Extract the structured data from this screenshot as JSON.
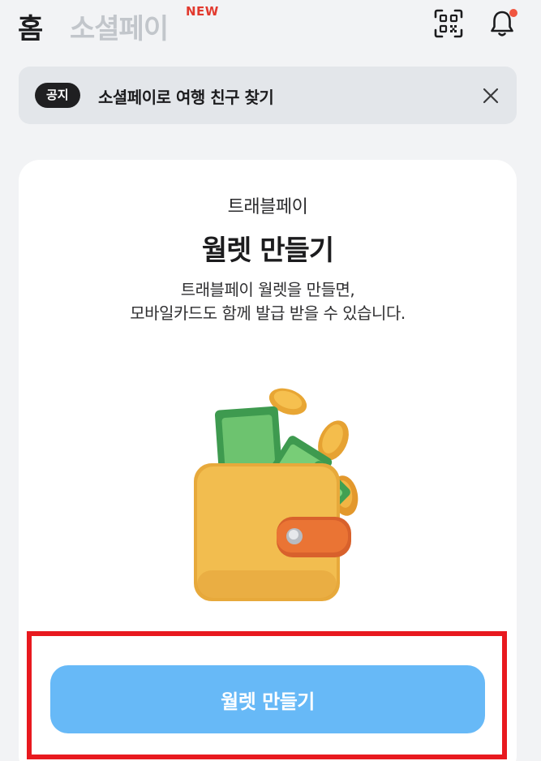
{
  "header": {
    "tab_home": "홈",
    "tab_socialpay": "소셜페이",
    "new_badge": "NEW"
  },
  "notice": {
    "badge": "공지",
    "text": "소셜페이로 여행 친구 찾기"
  },
  "card": {
    "subtitle": "트래블페이",
    "title": "월렛 만들기",
    "description_line1": "트래블페이 월렛을 만들면,",
    "description_line2": "모바일카드도 함께 발급 받을 수 있습니다."
  },
  "cta": {
    "label": "월렛 만들기"
  },
  "icons": {
    "qr": "qr-scan-icon",
    "bell": "bell-icon",
    "close": "close-icon",
    "wallet": "wallet-money-illustration"
  },
  "colors": {
    "cta_blue": "#67b9f7",
    "notice_bg": "#e3e6ea",
    "new_red": "#e2392e",
    "highlight_red": "#e8191f",
    "bell_dot": "#f0553f"
  }
}
